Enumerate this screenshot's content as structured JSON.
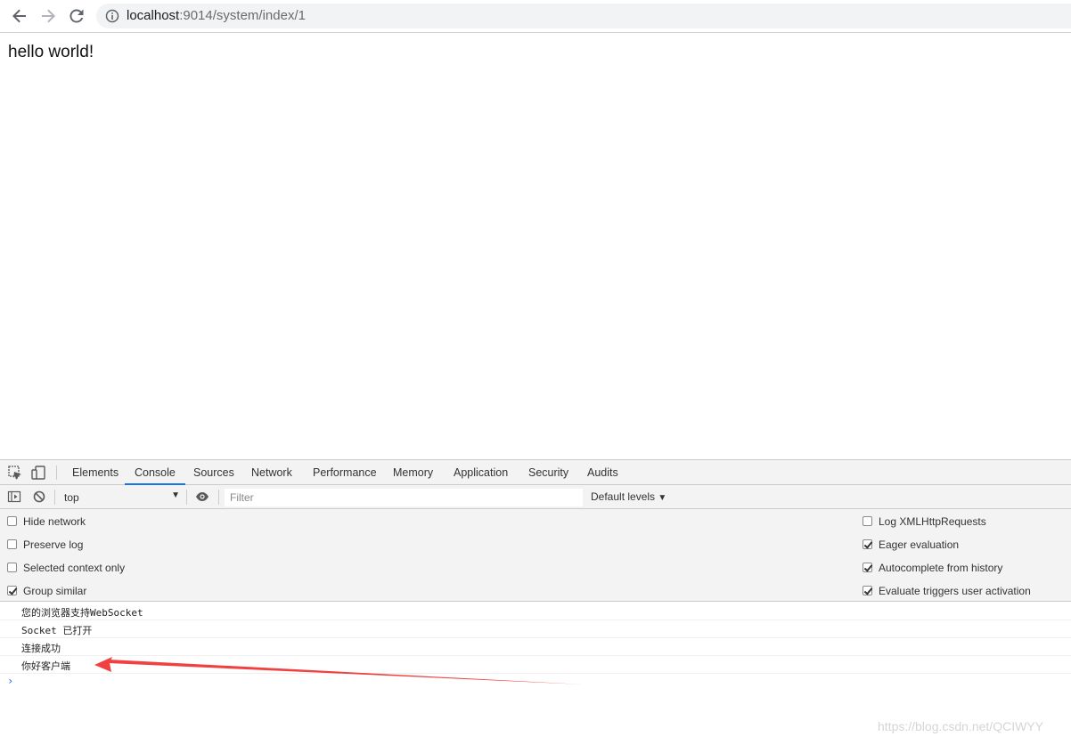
{
  "browser": {
    "url_host": "localhost",
    "url_path": ":9014/system/index/1",
    "icons": [
      "back-arrow-icon",
      "forward-arrow-icon",
      "reload-icon",
      "info-icon"
    ]
  },
  "page": {
    "heading": "hello world!"
  },
  "devtools": {
    "tabs": [
      {
        "label": "Elements",
        "active": false
      },
      {
        "label": "Console",
        "active": true
      },
      {
        "label": "Sources",
        "active": false
      },
      {
        "label": "Network",
        "active": false
      },
      {
        "label": "Performance",
        "active": false
      },
      {
        "label": "Memory",
        "active": false
      },
      {
        "label": "Application",
        "active": false
      },
      {
        "label": "Security",
        "active": false
      },
      {
        "label": "Audits",
        "active": false
      }
    ],
    "context": "top",
    "filter_placeholder": "Filter",
    "levels": "Default levels",
    "options_left": [
      {
        "label": "Hide network",
        "checked": false
      },
      {
        "label": "Preserve log",
        "checked": false
      },
      {
        "label": "Selected context only",
        "checked": false
      },
      {
        "label": "Group similar",
        "checked": true
      }
    ],
    "options_right": [
      {
        "label": "Log XMLHttpRequests",
        "checked": false
      },
      {
        "label": "Eager evaluation",
        "checked": true
      },
      {
        "label": "Autocomplete from history",
        "checked": true
      },
      {
        "label": "Evaluate triggers user activation",
        "checked": true
      }
    ],
    "messages": [
      "您的浏览器支持WebSocket",
      "Socket 已打开",
      "连接成功",
      "你好客户端"
    ],
    "prompt": "›"
  },
  "annotation": {
    "arrow_color": "#f04040"
  },
  "watermark": "https://blog.csdn.net/QCIWYY"
}
